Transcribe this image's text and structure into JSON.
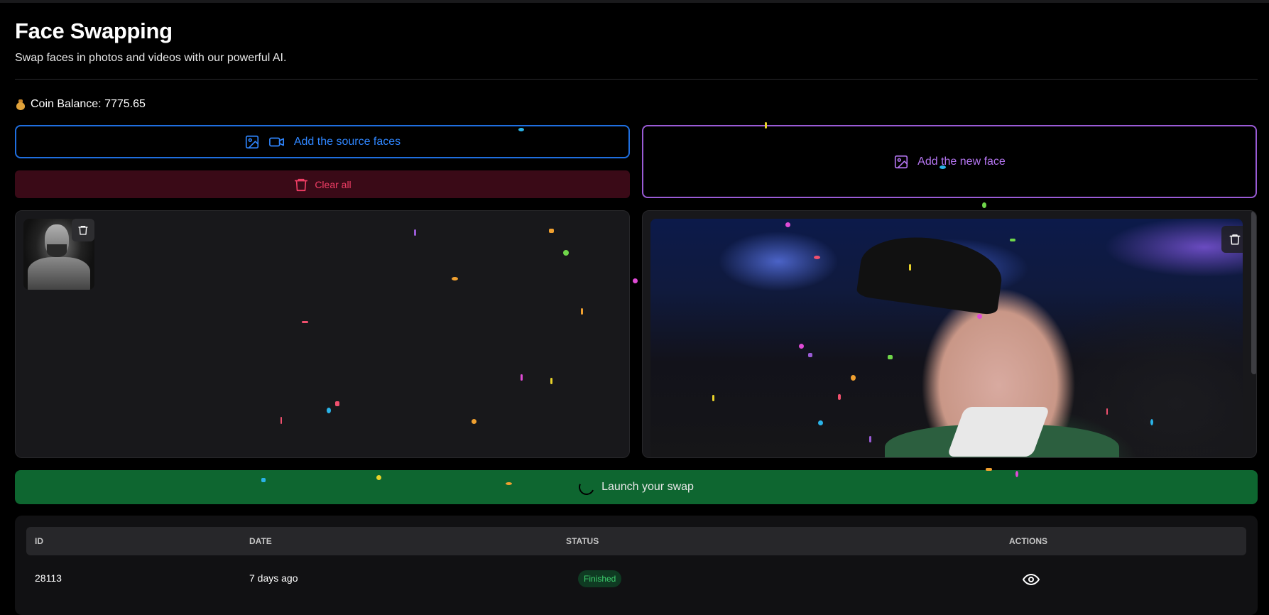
{
  "header": {
    "title": "Face Swapping",
    "subtitle": "Swap faces in photos and videos with our powerful AI."
  },
  "coins": {
    "icon": "money-bag-icon",
    "label": "Coin Balance: 7775.65"
  },
  "source": {
    "button_label": "Add the source faces",
    "icons": [
      "image-icon",
      "video-icon"
    ],
    "clear_label": "Clear all"
  },
  "target": {
    "button_label": "Add the new face",
    "icon": "image-icon"
  },
  "launch": {
    "label": "Launch your swap"
  },
  "history": {
    "columns": [
      "ID",
      "DATE",
      "STATUS",
      "ACTIONS"
    ],
    "rows": [
      {
        "id": "28113",
        "date": "7 days ago",
        "status": "Finished",
        "action_icon": "eye-icon"
      }
    ]
  },
  "colors": {
    "source_accent": "#1f6fe0",
    "target_accent": "#9a5bd6",
    "danger": "#f23e66",
    "launch_bg": "#0e6630",
    "status_finished": "#3ecf6e"
  }
}
